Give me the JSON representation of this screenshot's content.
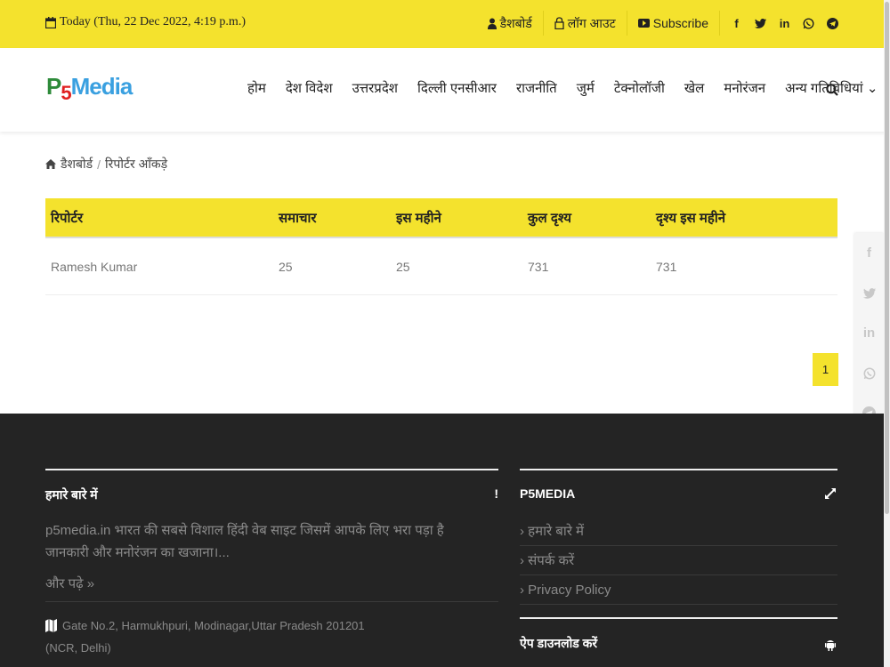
{
  "topbar": {
    "date": "Today (Thu, 22 Dec 2022, 4:19 p.m.)",
    "dashboard": "डैशबोर्ड",
    "logout": "लॉग आउट",
    "subscribe": "Subscribe",
    "social_icons": [
      "facebook-icon",
      "twitter-icon",
      "linkedin-icon",
      "whatsapp-icon",
      "telegram-icon"
    ]
  },
  "header": {
    "logo": {
      "p": "P",
      "five": "5",
      "media": "Media"
    },
    "nav": [
      {
        "label": "होम"
      },
      {
        "label": "देश विदेश"
      },
      {
        "label": "उत्तरप्रदेश"
      },
      {
        "label": "दिल्ली एनसीआर"
      },
      {
        "label": "राजनीति"
      },
      {
        "label": "जुर्म"
      },
      {
        "label": "टेक्नोलॉजी"
      },
      {
        "label": "खेल"
      },
      {
        "label": "मनोरंजन"
      },
      {
        "label": "अन्य गतिविधियां ⌄"
      }
    ]
  },
  "breadcrumb": {
    "home": "डैशबोर्ड",
    "sep": "/",
    "current": "रिपोर्टर आँकड़े"
  },
  "table": {
    "headers": [
      "रिपोर्टर",
      "समाचार",
      "इस महीने",
      "कुल दृश्य",
      "दृश्य इस महीने"
    ],
    "rows": [
      [
        "Ramesh Kumar",
        "25",
        "25",
        "731",
        "731"
      ]
    ]
  },
  "pagination": {
    "current": "1"
  },
  "share_icons": [
    "facebook-icon",
    "twitter-icon",
    "linkedin-icon",
    "whatsapp-icon",
    "telegram-icon"
  ],
  "footer": {
    "about": {
      "title": "हमारे बारे में",
      "bang": "!",
      "text": "p5media.in भारत की सबसे विशाल हिंदी वेब साइट जिसमें आपके लिए भरा पड़ा है जानकारी और मनोरंजन का खजाना।...",
      "more": "और पढ़े »",
      "address_line1": "Gate No.2, Harmukhpuri, Modinagar,Uttar Pradesh 201201",
      "address_line2": "(NCR, Delhi)"
    },
    "links": {
      "title": "P5MEDIA",
      "items": [
        "› हमारे बारे में",
        "› संपर्क करें",
        "› Privacy Policy"
      ]
    },
    "app": {
      "title": "ऐप डाउनलोड करें"
    }
  },
  "colors": {
    "accent": "#f4e22d",
    "footer_bg": "#242424"
  }
}
